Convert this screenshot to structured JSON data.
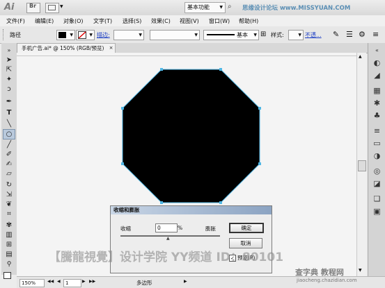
{
  "title_bar": {
    "app_logo": "Ai",
    "workspace": "基本功能",
    "watermark": "思缘设计论坛 www.MISSYUAN.COM"
  },
  "menu": [
    "文件(F)",
    "编辑(E)",
    "对象(O)",
    "文字(T)",
    "选择(S)",
    "效果(C)",
    "视图(V)",
    "窗口(W)",
    "帮助(H)"
  ],
  "control_bar": {
    "selection_type": "路径",
    "stroke_label": "描边:",
    "stroke_profile": "基本",
    "style_label": "样式:",
    "opacity_link": "不透..."
  },
  "document_tab": {
    "name": "手机广告.ai* @ 150% (RGB/预览)",
    "close": "×"
  },
  "canvas": {
    "shape": "octagon",
    "fill_color": "#000000",
    "selection_color": "#4fb6e4"
  },
  "dialog": {
    "title": "收缩和膨胀",
    "shrink_label": "收缩",
    "expand_label": "膨胀",
    "value": "0",
    "unit": "%",
    "ok": "确定",
    "cancel": "取消",
    "preview_label": "预览(P)",
    "preview_checked": "✓"
  },
  "status_bar": {
    "zoom": "150%",
    "page": "1",
    "tool": "多边形"
  },
  "watermarks": {
    "bottom": "【騰龍視覺】设计学院  YY频道 ID：80101",
    "corner": "查字典 教程网",
    "url": "jiaocheng.chazidian.com"
  },
  "tools_icons": [
    "selection-arrow-icon",
    "direct-select-icon",
    "magic-wand-icon",
    "lasso-icon",
    "pen-icon",
    "type-icon",
    "line-icon",
    "ellipse-icon",
    "paintbrush-icon",
    "pencil-icon",
    "blob-brush-icon",
    "eraser-icon",
    "rotate-icon",
    "scale-icon",
    "warp-icon",
    "free-transform-icon",
    "symbol-sprayer-icon",
    "graph-icon",
    "mesh-icon",
    "gradient-icon",
    "eyedropper-icon",
    "blend-icon",
    "live-paint-icon",
    "slice-icon",
    "scissors-icon",
    "hand-icon",
    "zoom-icon"
  ],
  "right_panel_icons": [
    "color-icon",
    "color-guide-icon",
    "swatches-icon",
    "brushes-icon",
    "symbols-icon",
    "stroke-icon",
    "gradient-panel-icon",
    "transparency-icon",
    "appearance-icon",
    "graphic-styles-icon",
    "layers-icon",
    "artboards-icon"
  ]
}
